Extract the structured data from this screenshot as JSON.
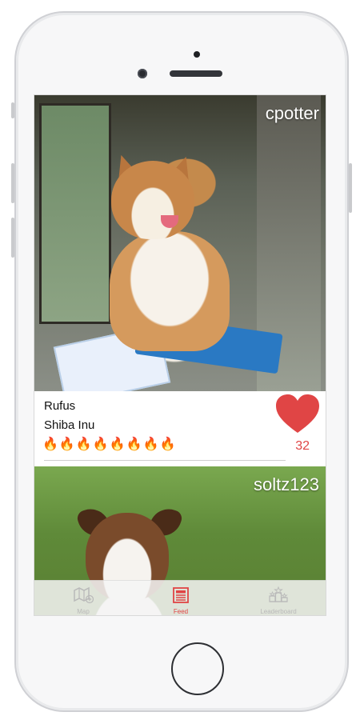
{
  "feed": {
    "posts": [
      {
        "username": "cpotter",
        "pet_name": "Rufus",
        "breed": "Shiba Inu",
        "fire_rating": "🔥🔥🔥🔥🔥🔥🔥🔥",
        "likes_count": "32"
      },
      {
        "username": "soltz123"
      }
    ]
  },
  "tabbar": {
    "items": [
      {
        "label": "Map",
        "icon": "map-icon",
        "active": false
      },
      {
        "label": "Feed",
        "icon": "feed-icon",
        "active": true
      },
      {
        "label": "Leaderboard",
        "icon": "leaderboard-icon",
        "active": false
      }
    ]
  },
  "colors": {
    "accent": "#e04545",
    "tab_inactive": "#b9b9b9"
  }
}
